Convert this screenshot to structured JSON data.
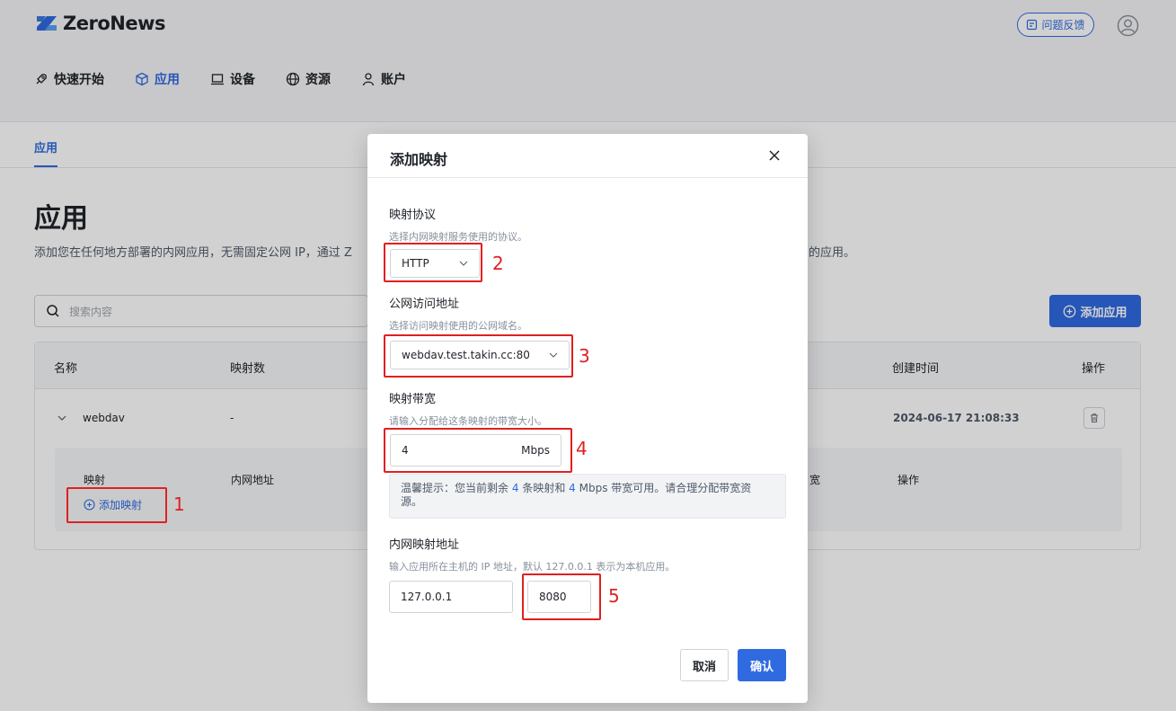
{
  "brand": {
    "name": "ZeroNews",
    "accent": "#2f6ae0"
  },
  "header": {
    "feedback_label": "问题反馈"
  },
  "nav": [
    {
      "label": "快速开始",
      "icon": "rocket-icon"
    },
    {
      "label": "应用",
      "icon": "cube-icon",
      "active": true
    },
    {
      "label": "设备",
      "icon": "laptop-icon"
    },
    {
      "label": "资源",
      "icon": "globe-icon"
    },
    {
      "label": "账户",
      "icon": "user-icon"
    }
  ],
  "subtab": {
    "label": "应用"
  },
  "page": {
    "title": "应用",
    "desc_head": "添加您在任何地方部署的内网应用，无需固定公网 IP，通过 Z",
    "desc_tail": "的应用。"
  },
  "search": {
    "placeholder": "搜索内容"
  },
  "add_app_label": "添加应用",
  "table": {
    "headers": {
      "name": "名称",
      "count": "映射数",
      "created": "创建时间",
      "actions": "操作"
    },
    "row": {
      "name": "webdav",
      "count": "-",
      "created": "2024-06-17 21:08:33"
    },
    "subpanel": {
      "mapping": "映射",
      "inner_addr": "内网地址",
      "bandwidth_tail": "宽",
      "actions": "操作",
      "add_mapping": "添加映射"
    }
  },
  "modal": {
    "title": "添加映射",
    "protocol": {
      "label": "映射协议",
      "hint": "选择内网映射服务使用的协议。",
      "value": "HTTP"
    },
    "public_addr": {
      "label": "公网访问地址",
      "hint": "选择访问映射使用的公网域名。",
      "value": "webdav.test.takin.cc:80"
    },
    "bandwidth": {
      "label": "映射带宽",
      "hint": "请输入分配给这条映射的带宽大小。",
      "value": "4",
      "unit": "Mbps"
    },
    "tip": {
      "prefix": "温馨提示：您当前剩余",
      "mappings_left": "4",
      "middle": "条映射和",
      "bandwidth_left": "4",
      "suffix_line1": "Mbps 带宽可用。请合理分配带宽资",
      "suffix_line2": "源。"
    },
    "inner_addr": {
      "label": "内网映射地址",
      "hint": "输入应用所在主机的 IP 地址，默认 127.0.0.1 表示为本机应用。",
      "ip": "127.0.0.1",
      "port": "8080"
    },
    "cancel_label": "取消",
    "confirm_label": "确认"
  },
  "annotations": [
    "1",
    "2",
    "3",
    "4",
    "5"
  ]
}
